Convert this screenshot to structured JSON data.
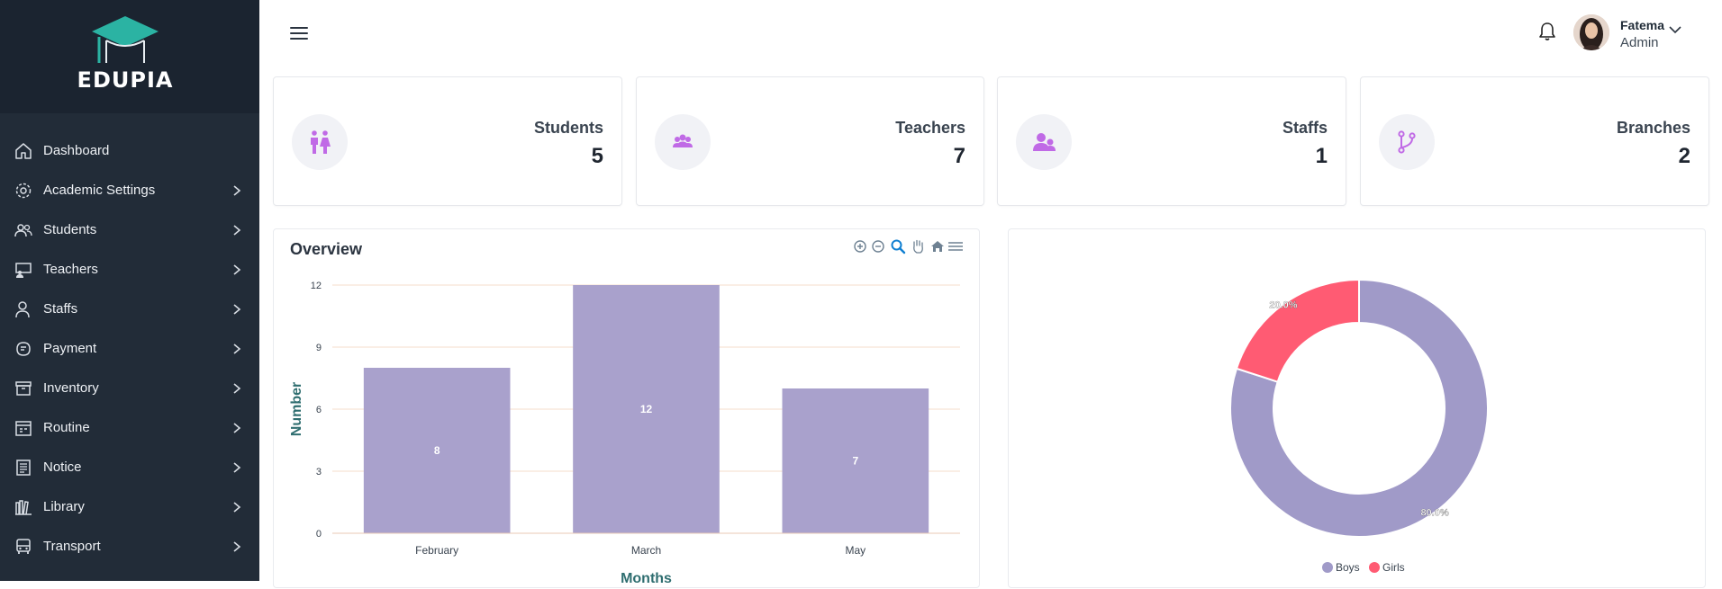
{
  "brand": {
    "name": "EDUPIA"
  },
  "sidebar": {
    "items": [
      {
        "label": "Dashboard",
        "icon": "home-icon",
        "has_children": false
      },
      {
        "label": "Academic Settings",
        "icon": "gear-icon",
        "has_children": true
      },
      {
        "label": "Students",
        "icon": "users-icon",
        "has_children": true
      },
      {
        "label": "Teachers",
        "icon": "teacher-icon",
        "has_children": true
      },
      {
        "label": "Staffs",
        "icon": "staff-icon",
        "has_children": true
      },
      {
        "label": "Payment",
        "icon": "payment-icon",
        "has_children": true
      },
      {
        "label": "Inventory",
        "icon": "archive-icon",
        "has_children": true
      },
      {
        "label": "Routine",
        "icon": "calendar-icon",
        "has_children": true
      },
      {
        "label": "Notice",
        "icon": "notice-icon",
        "has_children": true
      },
      {
        "label": "Library",
        "icon": "library-icon",
        "has_children": true
      },
      {
        "label": "Transport",
        "icon": "bus-icon",
        "has_children": true
      }
    ]
  },
  "header": {
    "user": {
      "name": "Fatema",
      "role": "Admin"
    }
  },
  "stats": [
    {
      "label": "Students",
      "value": "5",
      "icon": "students-icon"
    },
    {
      "label": "Teachers",
      "value": "7",
      "icon": "group-icon"
    },
    {
      "label": "Staffs",
      "value": "1",
      "icon": "staff-group-icon"
    },
    {
      "label": "Branches",
      "value": "2",
      "icon": "branch-icon"
    }
  ],
  "overview": {
    "title": "Overview"
  },
  "colors": {
    "accent": "#c06ae6",
    "bar": "#a9a1cc",
    "boys": "#a09ac8",
    "girls": "#ff5b73",
    "sidebar": "#222c38",
    "axis_title": "#2f6e70",
    "logo": "#2bb3a3"
  },
  "chart_data": [
    {
      "type": "bar",
      "title": "Overview",
      "categories": [
        "February",
        "March",
        "May"
      ],
      "values": [
        8,
        12,
        7
      ],
      "xlabel": "Months",
      "ylabel": "Number",
      "ylim": [
        0,
        12
      ],
      "yticks": [
        0,
        3,
        6,
        9,
        12
      ],
      "grid": true,
      "data_labels": true
    },
    {
      "type": "pie",
      "donut": true,
      "slices": [
        {
          "label": "Boys",
          "value": 80.0,
          "display": "80.0%"
        },
        {
          "label": "Girls",
          "value": 20.0,
          "display": "20.0%"
        }
      ],
      "legend": "bottom-center"
    }
  ]
}
